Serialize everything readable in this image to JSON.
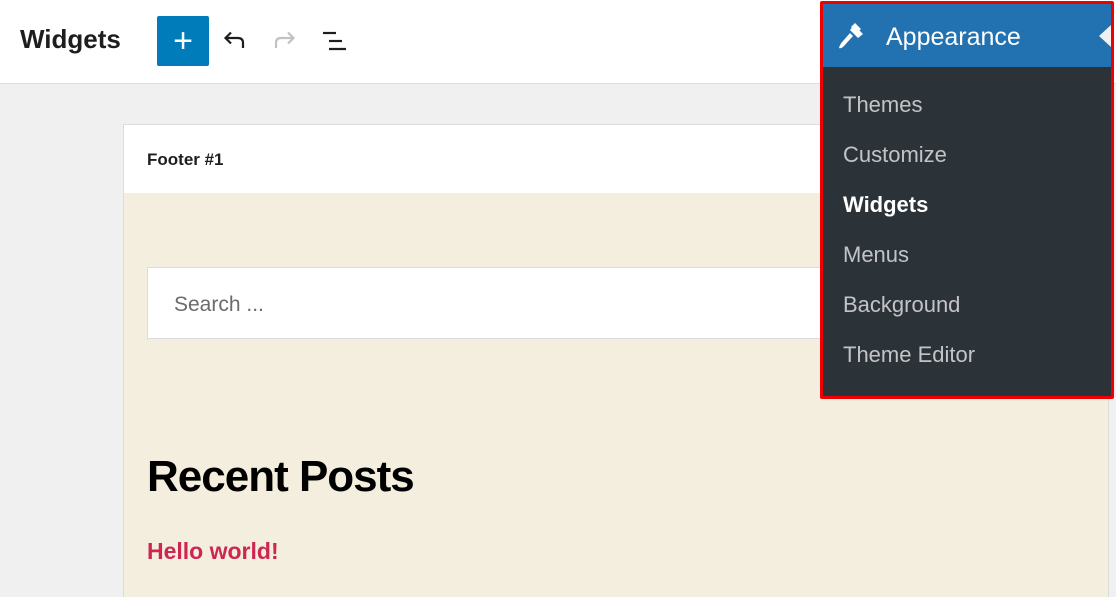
{
  "header": {
    "title": "Widgets",
    "add_label": "+"
  },
  "panel": {
    "title": "Footer #1",
    "search": {
      "placeholder": "Search ..."
    },
    "recent_heading": "Recent Posts",
    "posts": [
      "Hello world!"
    ]
  },
  "flyout": {
    "title": "Appearance",
    "items": [
      {
        "label": "Themes",
        "current": false
      },
      {
        "label": "Customize",
        "current": false
      },
      {
        "label": "Widgets",
        "current": true
      },
      {
        "label": "Menus",
        "current": false
      },
      {
        "label": "Background",
        "current": false
      },
      {
        "label": "Theme Editor",
        "current": false
      }
    ]
  },
  "colors": {
    "accent": "#007cba",
    "admin_menu_bg": "#2c3338",
    "admin_menu_active": "#2271b1",
    "highlight_border": "#ee0000",
    "link": "#cd2653",
    "panel_bg": "#f4eede"
  },
  "icons": [
    "plus-icon",
    "undo-icon",
    "redo-icon",
    "list-view-icon",
    "paintbrush-icon"
  ]
}
